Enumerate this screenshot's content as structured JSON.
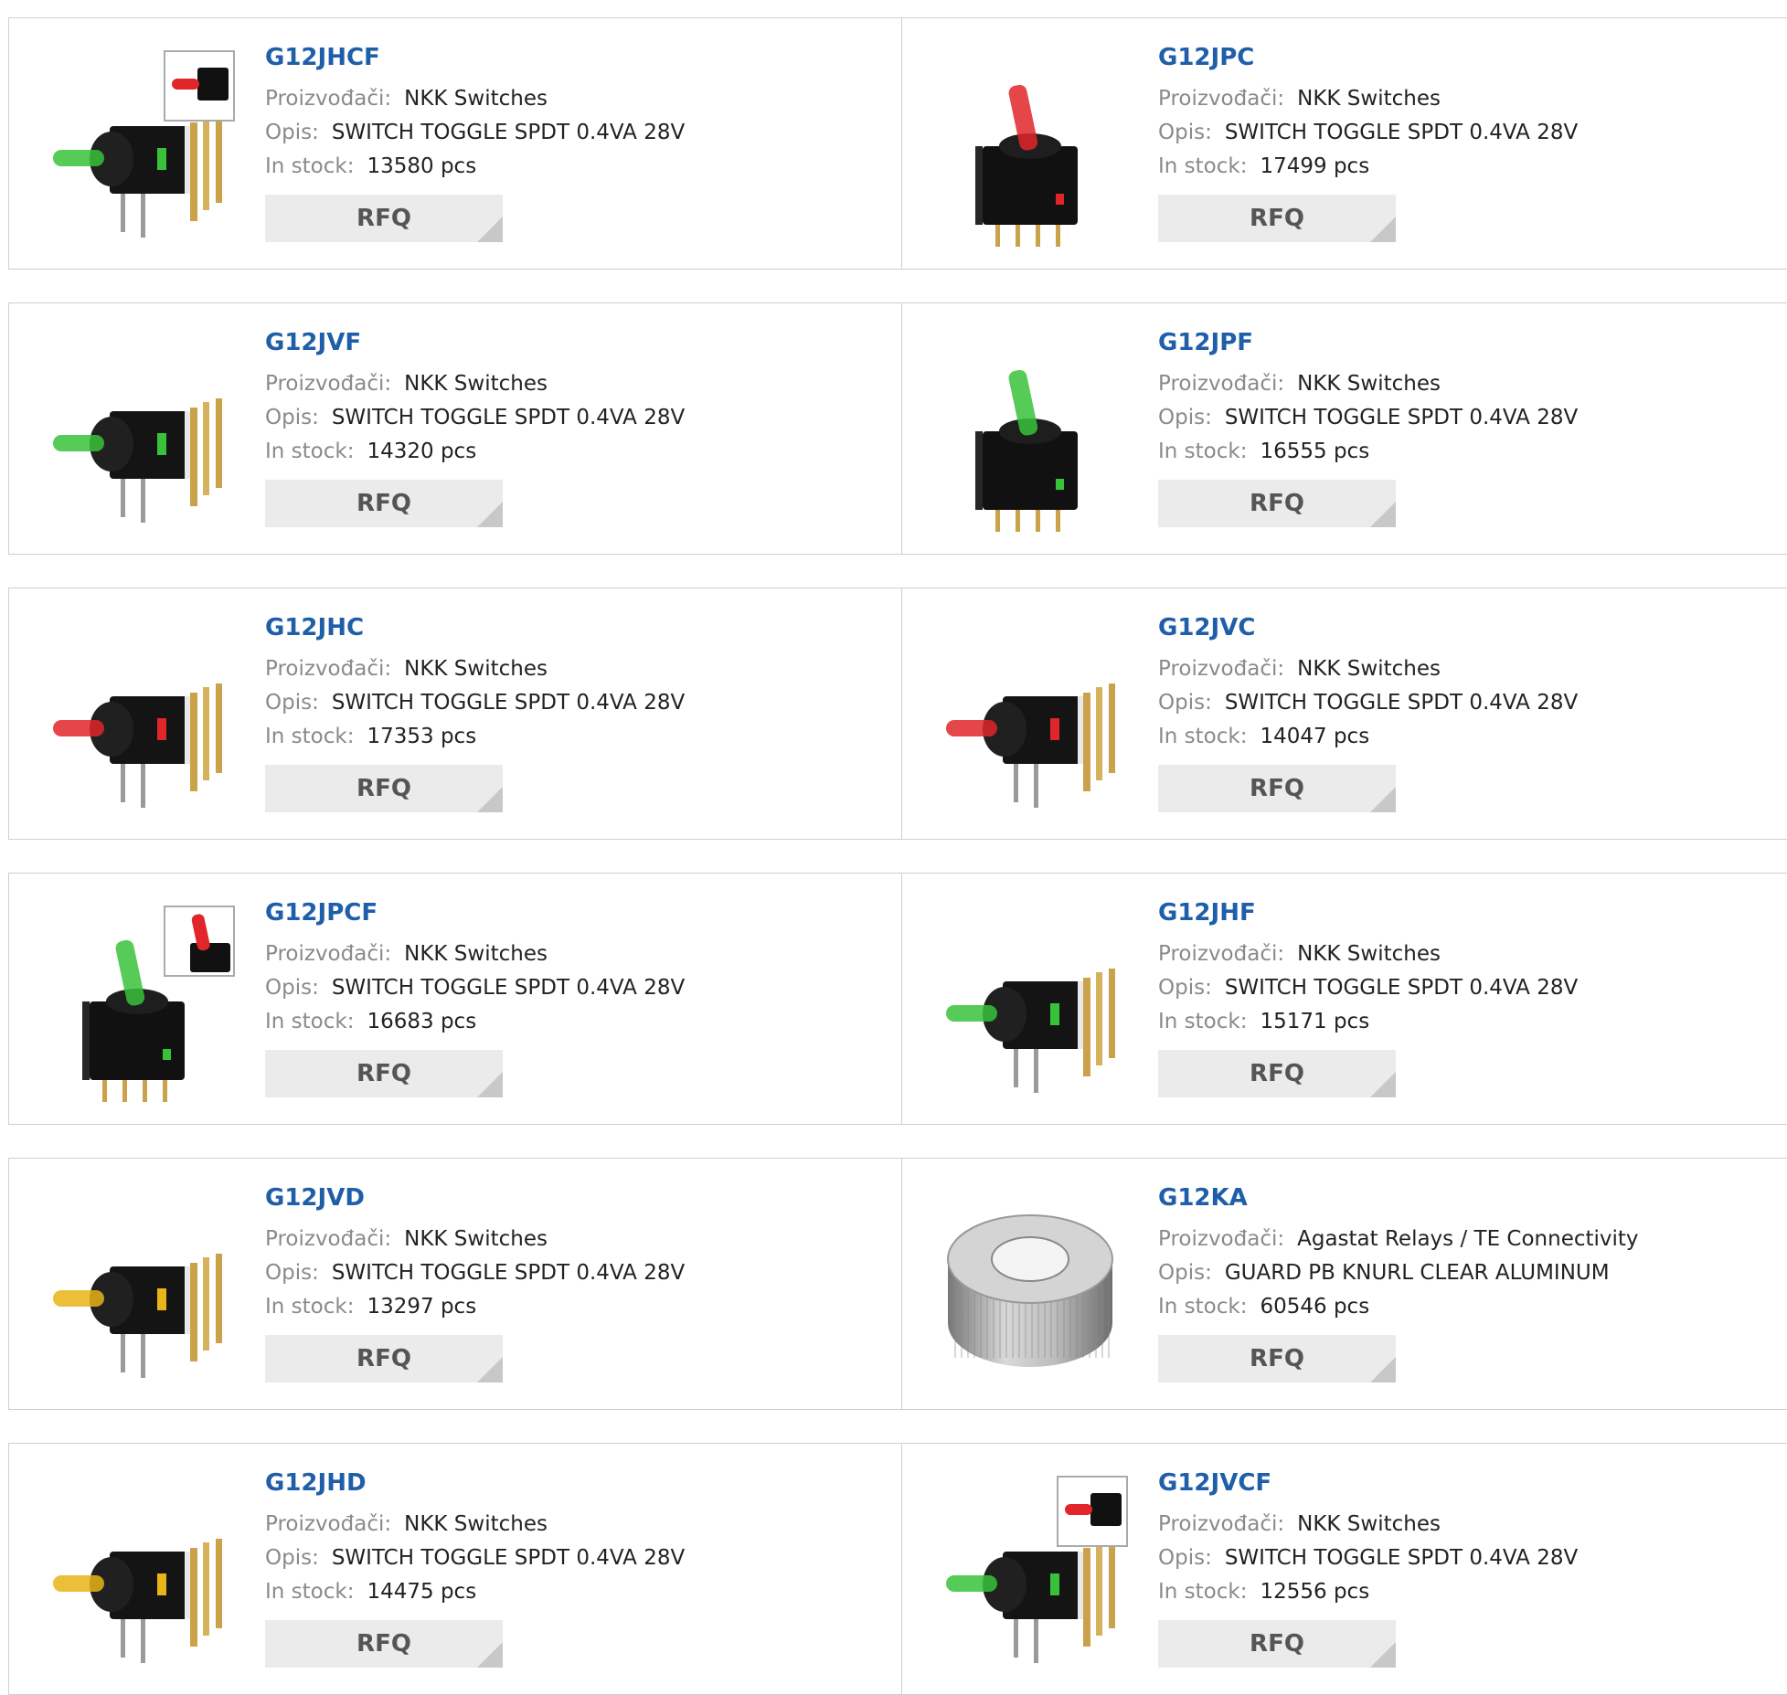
{
  "colors": {
    "title": "#1f5ea8",
    "label": "#8a8a8a",
    "button_bg": "#ebebeb",
    "border": "#cfcfcf"
  },
  "labels": {
    "manufacturer": "Proizvođači:",
    "description": "Opis:",
    "stock": "In stock:",
    "rfq": "RFQ"
  },
  "products": [
    {
      "part": "G12JHCF",
      "manufacturer": "NKK Switches",
      "description": "SWITCH TOGGLE SPDT 0.4VA 28V",
      "stock": "13580 pcs",
      "image": "toggle-switch-right-angle-green-inset-red",
      "lever_color": "#38c23a",
      "inset": "#e0262a"
    },
    {
      "part": "G12JPC",
      "manufacturer": "NKK Switches",
      "description": "SWITCH TOGGLE SPDT 0.4VA 28V",
      "stock": "17499 pcs",
      "image": "toggle-switch-vertical-red",
      "lever_color": "#e0262a"
    },
    {
      "part": "G12JVF",
      "manufacturer": "NKK Switches",
      "description": "SWITCH TOGGLE SPDT 0.4VA 28V",
      "stock": "14320 pcs",
      "image": "toggle-switch-right-angle-green",
      "lever_color": "#38c23a"
    },
    {
      "part": "G12JPF",
      "manufacturer": "NKK Switches",
      "description": "SWITCH TOGGLE SPDT 0.4VA 28V",
      "stock": "16555 pcs",
      "image": "toggle-switch-vertical-green",
      "lever_color": "#38c23a"
    },
    {
      "part": "G12JHC",
      "manufacturer": "NKK Switches",
      "description": "SWITCH TOGGLE SPDT 0.4VA 28V",
      "stock": "17353 pcs",
      "image": "toggle-switch-right-angle-red",
      "lever_color": "#e0262a"
    },
    {
      "part": "G12JVC",
      "manufacturer": "NKK Switches",
      "description": "SWITCH TOGGLE SPDT 0.4VA 28V",
      "stock": "14047 pcs",
      "image": "toggle-switch-right-angle-red",
      "lever_color": "#e0262a"
    },
    {
      "part": "G12JPCF",
      "manufacturer": "NKK Switches",
      "description": "SWITCH TOGGLE SPDT 0.4VA 28V",
      "stock": "16683 pcs",
      "image": "toggle-switch-vertical-green-inset-red",
      "lever_color": "#38c23a",
      "inset": "#e0262a"
    },
    {
      "part": "G12JHF",
      "manufacturer": "NKK Switches",
      "description": "SWITCH TOGGLE SPDT 0.4VA 28V",
      "stock": "15171 pcs",
      "image": "toggle-switch-right-angle-green",
      "lever_color": "#38c23a"
    },
    {
      "part": "G12JVD",
      "manufacturer": "NKK Switches",
      "description": "SWITCH TOGGLE SPDT 0.4VA 28V",
      "stock": "13297 pcs",
      "image": "toggle-switch-right-angle-yellow",
      "lever_color": "#e8b418"
    },
    {
      "part": "G12KA",
      "manufacturer": "Agastat Relays / TE Connectivity",
      "description": "GUARD PB KNURL CLEAR ALUMINUM",
      "stock": "60546 pcs",
      "image": "knurled-aluminum-guard"
    },
    {
      "part": "G12JHD",
      "manufacturer": "NKK Switches",
      "description": "SWITCH TOGGLE SPDT 0.4VA 28V",
      "stock": "14475 pcs",
      "image": "toggle-switch-right-angle-yellow",
      "lever_color": "#e8b418"
    },
    {
      "part": "G12JVCF",
      "manufacturer": "NKK Switches",
      "description": "SWITCH TOGGLE SPDT 0.4VA 28V",
      "stock": "12556 pcs",
      "image": "toggle-switch-right-angle-green-inset-red",
      "lever_color": "#38c23a",
      "inset": "#e0262a"
    }
  ]
}
